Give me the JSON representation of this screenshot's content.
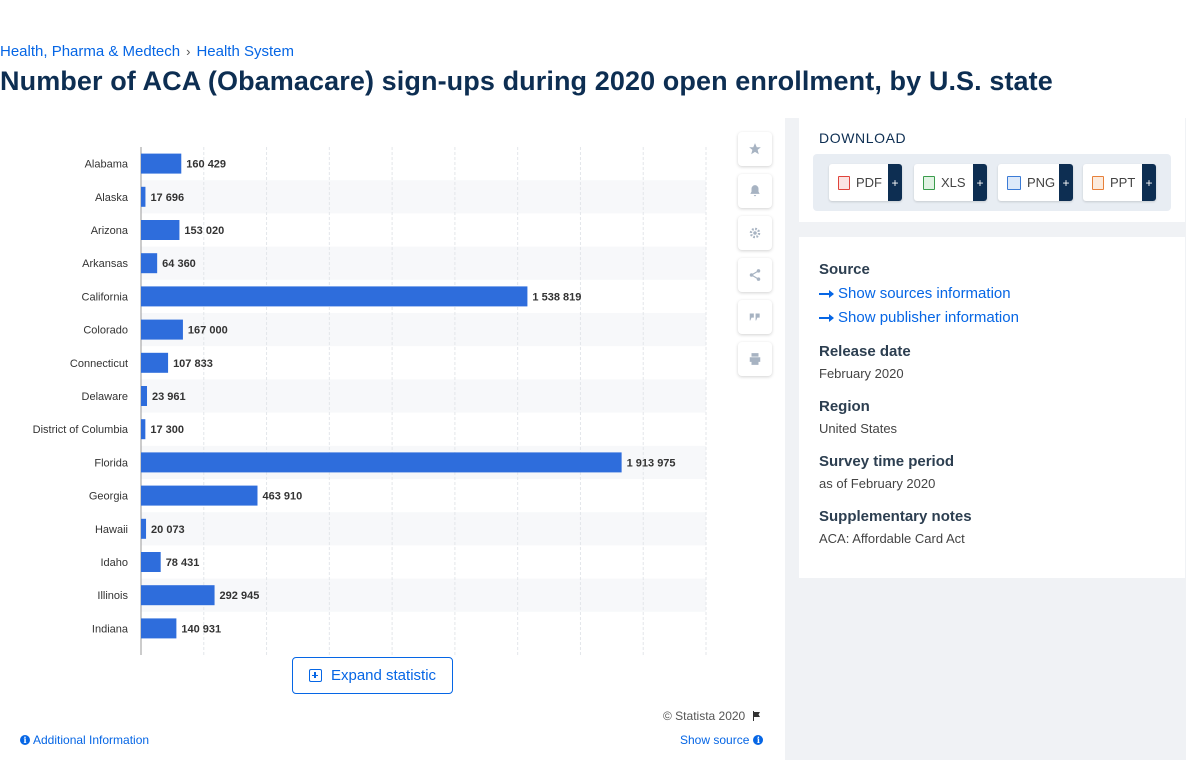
{
  "breadcrumb": {
    "category": "Health, Pharma & Medtech",
    "separator": "›",
    "subcategory": "Health System"
  },
  "page_title": "Number of ACA (Obamacare) sign-ups during 2020 open enrollment, by U.S. state",
  "toolbar": {
    "icons": [
      "star-icon",
      "bell-icon",
      "gear-icon",
      "share-icon",
      "quote-icon",
      "print-icon"
    ]
  },
  "chart_data": {
    "type": "bar",
    "orientation": "horizontal",
    "categories": [
      "Alabama",
      "Alaska",
      "Arizona",
      "Arkansas",
      "California",
      "Colorado",
      "Connecticut",
      "Delaware",
      "District of Columbia",
      "Florida",
      "Georgia",
      "Hawaii",
      "Idaho",
      "Illinois",
      "Indiana"
    ],
    "values": [
      160429,
      17696,
      153020,
      64360,
      1538819,
      167000,
      107833,
      23961,
      17300,
      1913975,
      463910,
      20073,
      78431,
      292945,
      140931
    ],
    "value_labels": [
      "160 429",
      "17 696",
      "153 020",
      "64 360",
      "1 538 819",
      "167 000",
      "107 833",
      "23 961",
      "17 300",
      "1 913 975",
      "463 910",
      "20 073",
      "78 431",
      "292 945",
      "140 931"
    ],
    "xlim": [
      0,
      2250000
    ],
    "grid": true,
    "bar_color": "#2e6ddc"
  },
  "expand_label": "Expand statistic",
  "copyright": "© Statista 2020",
  "additional_info": "Additional Information",
  "show_source": "Show source",
  "download": {
    "title": "DOWNLOAD",
    "formats": [
      {
        "label": "PDF",
        "color": "#e0433b"
      },
      {
        "label": "XLS",
        "color": "#3a9c4c"
      },
      {
        "label": "PNG",
        "color": "#3b7bd6"
      },
      {
        "label": "PPT",
        "color": "#e7803a"
      }
    ],
    "plus": "+"
  },
  "info": {
    "source_label": "Source",
    "show_sources": "Show sources information",
    "show_publisher": "Show publisher information",
    "release_label": "Release date",
    "release_value": "February 2020",
    "region_label": "Region",
    "region_value": "United States",
    "survey_label": "Survey time period",
    "survey_value": "as of February 2020",
    "notes_label": "Supplementary notes",
    "notes_value": "ACA: Affordable Card Act"
  }
}
